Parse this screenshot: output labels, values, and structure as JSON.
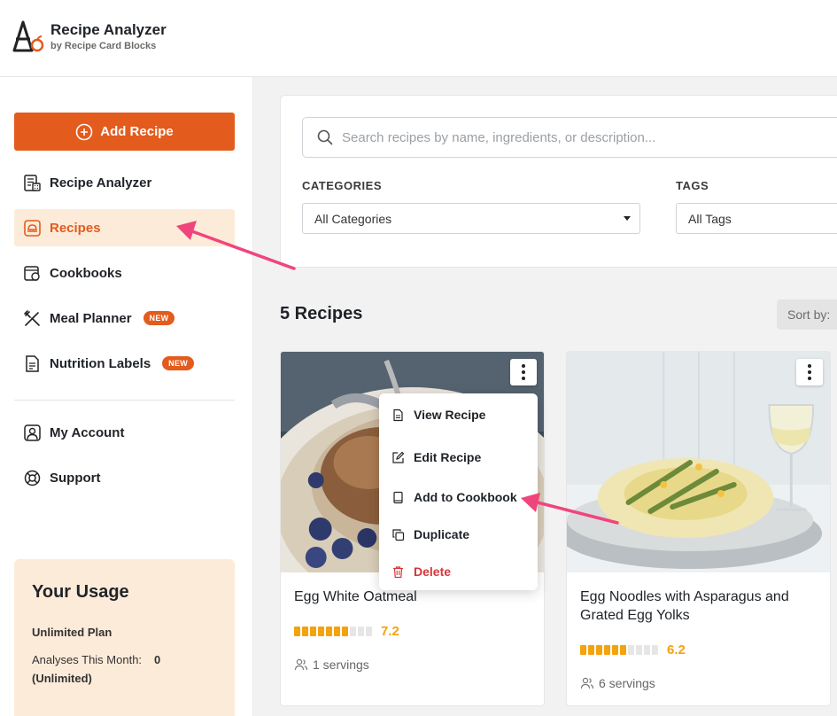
{
  "brand": {
    "title": "Recipe Analyzer",
    "subtitle": "by Recipe Card Blocks",
    "accent": "#e35b1d"
  },
  "sidebar": {
    "add_button": "Add Recipe",
    "items": [
      {
        "label": "Recipe Analyzer",
        "icon": "calculator-icon"
      },
      {
        "label": "Recipes",
        "icon": "recipe-card-icon",
        "active": true
      },
      {
        "label": "Cookbooks",
        "icon": "cookbook-icon"
      },
      {
        "label": "Meal Planner",
        "icon": "utensils-icon",
        "badge": "NEW"
      },
      {
        "label": "Nutrition Labels",
        "icon": "document-icon",
        "badge": "NEW"
      },
      {
        "label": "My Account",
        "icon": "user-icon"
      },
      {
        "label": "Support",
        "icon": "lifebuoy-icon"
      }
    ],
    "usage": {
      "title": "Your Usage",
      "plan": "Unlimited Plan",
      "analyses_label": "Analyses This Month:",
      "analyses_value": "0",
      "analyses_note": "(Unlimited)"
    }
  },
  "filters": {
    "search_placeholder": "Search recipes by name, ingredients, or description...",
    "categories_label": "CATEGORIES",
    "categories_value": "All Categories",
    "tags_label": "TAGS",
    "tags_value": "All Tags"
  },
  "list": {
    "count": "5 Recipes",
    "sort_label": "Sort by:"
  },
  "recipes": [
    {
      "title": "Egg White Oatmeal",
      "rating": 7.2,
      "rating_label": "7.2",
      "servings": "1 servings"
    },
    {
      "title": "Egg Noodles with Asparagus and Grated Egg Yolks",
      "rating": 6.2,
      "rating_label": "6.2",
      "servings": "6 servings"
    }
  ],
  "context_menu": {
    "items": [
      {
        "label": "View Recipe",
        "icon": "document-icon"
      },
      {
        "label": "Edit Recipe",
        "icon": "edit-icon"
      },
      {
        "label": "Add to Cookbook",
        "icon": "book-icon"
      },
      {
        "label": "Duplicate",
        "icon": "duplicate-icon"
      },
      {
        "label": "Delete",
        "icon": "trash-icon",
        "danger": true
      }
    ]
  },
  "annotation_color": "#f0457c"
}
